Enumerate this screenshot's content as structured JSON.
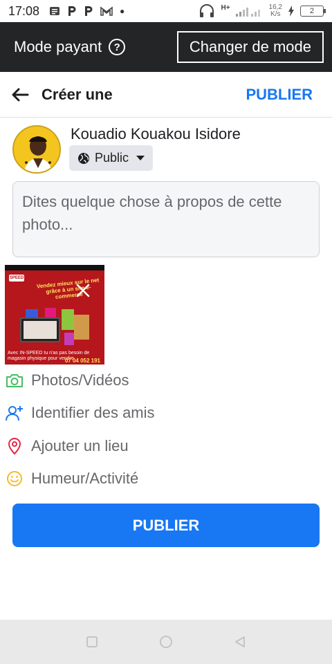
{
  "status_bar": {
    "time": "17:08",
    "network_type": "H+",
    "speed_value": "16,2",
    "speed_unit": "K/s",
    "battery_level": "2"
  },
  "mode_bar": {
    "label": "Mode payant",
    "help_symbol": "?",
    "change_button": "Changer de mode"
  },
  "header": {
    "title": "Créer une",
    "publish_label": "PUBLIER"
  },
  "user": {
    "name": "Kouadio Kouakou Isidore",
    "privacy": "Public"
  },
  "composer": {
    "placeholder": "Dites quelque chose à propos de cette photo..."
  },
  "actions": [
    {
      "label": "Photos/Vidéos",
      "icon": "camera-icon",
      "color": "#45bd62"
    },
    {
      "label": "Identifier des amis",
      "icon": "tag-friends-icon",
      "color": "#1877f2"
    },
    {
      "label": "Ajouter un lieu",
      "icon": "location-pin-icon",
      "color": "#e42645"
    },
    {
      "label": "Humeur/Activité",
      "icon": "smiley-icon",
      "color": "#f7b928"
    }
  ],
  "publish_button": "PUBLIER",
  "colors": {
    "accent": "#1877f2",
    "mode_bar_bg": "#242526",
    "composer_bg": "#f5f6f7"
  }
}
